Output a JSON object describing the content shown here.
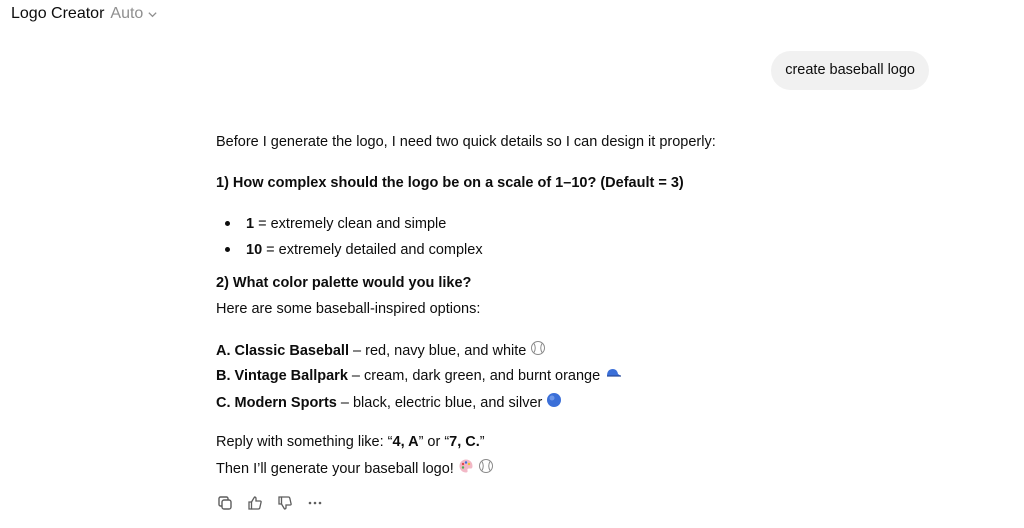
{
  "header": {
    "title": "Logo Creator",
    "mode": "Auto"
  },
  "user_message": "create baseball logo",
  "assistant": {
    "intro": "Before I generate the logo, I need two quick details so I can design it properly:",
    "q1": "1) How complex should the logo be on a scale of 1–10? (Default = 3)",
    "bullets": [
      {
        "strong": "1",
        "text": " = extremely clean and simple"
      },
      {
        "strong": "10",
        "text": " = extremely detailed and complex"
      }
    ],
    "q2": "2) What color palette would you like?",
    "q2_sub": "Here are some baseball-inspired options:",
    "options": [
      {
        "label": "A. Classic Baseball",
        "text": " – red, navy blue, and white",
        "icon": "baseball-icon"
      },
      {
        "label": "B. Vintage Ballpark",
        "text": " – cream, dark green, and burnt orange",
        "icon": "cap-icon"
      },
      {
        "label": "C. Modern Sports",
        "text": " – black, electric blue, and silver",
        "icon": "blue-circle-icon"
      }
    ],
    "reply_prefix": "Reply with something like: “",
    "reply_ex1": "4, A",
    "reply_mid": "” or “",
    "reply_ex2": "7, C.",
    "reply_suffix": "”",
    "closing": "Then I’ll generate your baseball logo!",
    "closing_icons": [
      "palette-icon",
      "baseball-icon"
    ]
  },
  "actions": [
    "copy-icon",
    "thumbs-up-icon",
    "thumbs-down-icon",
    "more-icon"
  ],
  "colors": {
    "text": "#0d0d0d",
    "muted": "#8f8f8f",
    "bubble": "#f1f1f1",
    "icon": "#5d5d5d",
    "blue": "#3b6fd8"
  }
}
